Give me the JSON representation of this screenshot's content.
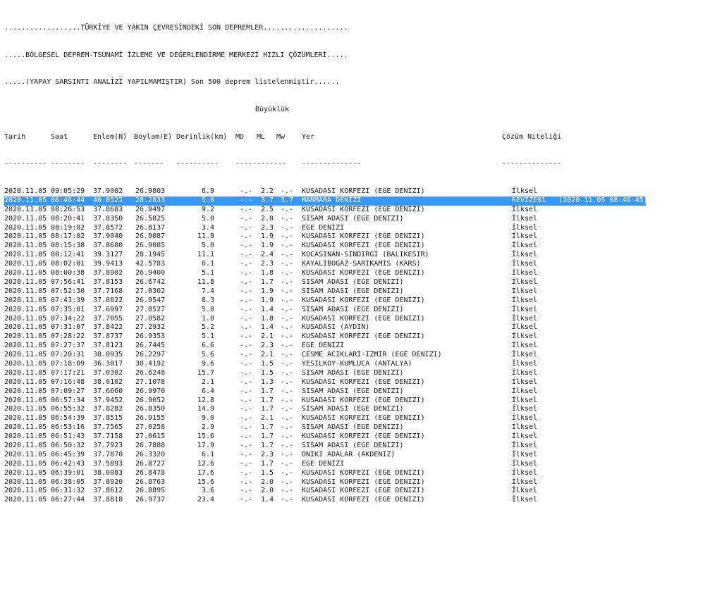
{
  "header": {
    "lines": [
      "..................TÜRKİYE VE YAKIN ÇEVRESİNDEKİ SON DEPREMLER....................",
      ".....BÖLGESEL DEPREM-TSUNAMİ İZLEME VE DEĞERLENDİRME MERKEZİ HIZLI ÇÖZÜMLERİ.....",
      ".....(YAPAY SARSINTI ANALİZİ YAPILMAMIŞTIR) Son 500 deprem listelenmiştir......"
    ],
    "magnitude_group": "Büyüklük"
  },
  "columns": {
    "date": "Tarih",
    "time": "Saat",
    "lat": "Enlem(N)",
    "lon": "Boylam(E)",
    "depth": "Derinlik(km)",
    "md": "MD",
    "ml": "ML",
    "mw": "Mw",
    "location": "Yer",
    "quality": "Çözüm Niteliği"
  },
  "rule": {
    "date": "----------",
    "time": "--------",
    "lat": "--------",
    "lon": "-------",
    "depth": "----------",
    "mag": "------------",
    "location": "--------------",
    "quality": "--------------"
  },
  "selected_index": 1,
  "rows": [
    {
      "date": "2020.11.05",
      "time": "09:05:29",
      "lat": "37.9002",
      "lon": "26.9803",
      "depth": "6.9",
      "md": "-.-",
      "ml": "2.2",
      "mw": "-.-",
      "location": "KUSADASI KORFEZI (EGE DENIZI)",
      "quality": "İlksel"
    },
    {
      "date": "2020.11.05",
      "time": "08:46:44",
      "lat": "40.8522",
      "lon": "28.2833",
      "depth": "5.0",
      "md": "-.-",
      "ml": "3.7",
      "mw": "3.7",
      "location": "MARMARA DENIZI",
      "quality": "REVIZE01   (2020.11.05 08:46:45)"
    },
    {
      "date": "2020.11.05",
      "time": "08:26:53",
      "lat": "37.8683",
      "lon": "26.9497",
      "depth": "9.2",
      "md": "-.-",
      "ml": "2.5",
      "mw": "-.-",
      "location": "KUSADASI KORFEZI (EGE DENIZI)",
      "quality": "İlksel"
    },
    {
      "date": "2020.11.05",
      "time": "08:20:41",
      "lat": "37.8350",
      "lon": "26.5825",
      "depth": "5.0",
      "md": "-.-",
      "ml": "2.0",
      "mw": "-.-",
      "location": "SISAM ADASI (EGE DENIZI)",
      "quality": "İlksel"
    },
    {
      "date": "2020.11.05",
      "time": "08:19:02",
      "lat": "37.8572",
      "lon": "26.8137",
      "depth": "3.4",
      "md": "-.-",
      "ml": "2.3",
      "mw": "-.-",
      "location": "EGE DENIZI",
      "quality": "İlksel"
    },
    {
      "date": "2020.11.05",
      "time": "08:17:02",
      "lat": "37.9040",
      "lon": "26.9087",
      "depth": "11.9",
      "md": "-.-",
      "ml": "1.9",
      "mw": "-.-",
      "location": "KUSADASI KORFEZI (EGE DENIZI)",
      "quality": "İlksel"
    },
    {
      "date": "2020.11.05",
      "time": "08:15:38",
      "lat": "37.8680",
      "lon": "26.9085",
      "depth": "5.0",
      "md": "-.-",
      "ml": "1.9",
      "mw": "-.-",
      "location": "KUSADASI KORFEZI (EGE DENIZI)",
      "quality": "İlksel"
    },
    {
      "date": "2020.11.05",
      "time": "08:12:41",
      "lat": "39.3127",
      "lon": "28.1945",
      "depth": "11.1",
      "md": "-.-",
      "ml": "2.4",
      "mw": "-.-",
      "location": "KOCASINAN-SINDIRGI (BALIKESIR)",
      "quality": "İlksel"
    },
    {
      "date": "2020.11.05",
      "time": "08:02:01",
      "lat": "39.9413",
      "lon": "42.5783",
      "depth": "6.1",
      "md": "-.-",
      "ml": "2.3",
      "mw": "-.-",
      "location": "KAYALIBOGAZ-SARIKAMIS (KARS)",
      "quality": "İlksel"
    },
    {
      "date": "2020.11.05",
      "time": "08:00:38",
      "lat": "37.8902",
      "lon": "26.9400",
      "depth": "5.1",
      "md": "-.-",
      "ml": "1.8",
      "mw": "-.-",
      "location": "KUSADASI KORFEZI (EGE DENIZI)",
      "quality": "İlksel"
    },
    {
      "date": "2020.11.05",
      "time": "07:56:41",
      "lat": "37.8153",
      "lon": "26.6742",
      "depth": "11.8",
      "md": "-.-",
      "ml": "1.7",
      "mw": "-.-",
      "location": "SISAM ADASI (EGE DENIZI)",
      "quality": "İlksel"
    },
    {
      "date": "2020.11.05",
      "time": "07:52:30",
      "lat": "37.7168",
      "lon": "27.0302",
      "depth": "7.4",
      "md": "-.-",
      "ml": "1.9",
      "mw": "-.-",
      "location": "SISAM ADASI (EGE DENIZI)",
      "quality": "İlksel"
    },
    {
      "date": "2020.11.05",
      "time": "07:43:39",
      "lat": "37.8822",
      "lon": "26.9547",
      "depth": "8.3",
      "md": "-.-",
      "ml": "1.9",
      "mw": "-.-",
      "location": "KUSADASI KORFEZI (EGE DENIZI)",
      "quality": "İlksel"
    },
    {
      "date": "2020.11.05",
      "time": "07:35:01",
      "lat": "37.6997",
      "lon": "27.0527",
      "depth": "5.0",
      "md": "-.-",
      "ml": "1.4",
      "mw": "-.-",
      "location": "SISAM ADASI (EGE DENIZI)",
      "quality": "İlksel"
    },
    {
      "date": "2020.11.05",
      "time": "07:34:22",
      "lat": "37.7055",
      "lon": "27.0582",
      "depth": "1.0",
      "md": "-.-",
      "ml": "1.8",
      "mw": "-.-",
      "location": "KUSADASI KORFEZI (EGE DENIZI)",
      "quality": "İlksel"
    },
    {
      "date": "2020.11.05",
      "time": "07:31:07",
      "lat": "37.8422",
      "lon": "27.2932",
      "depth": "5.2",
      "md": "-.-",
      "ml": "1.4",
      "mw": "-.-",
      "location": "KUSADASI (AYDIN)",
      "quality": "İlksel"
    },
    {
      "date": "2020.11.05",
      "time": "07:28:22",
      "lat": "37.8737",
      "lon": "26.9353",
      "depth": "5.1",
      "md": "-.-",
      "ml": "2.1",
      "mw": "-.-",
      "location": "KUSADASI KORFEZI (EGE DENIZI)",
      "quality": "İlksel"
    },
    {
      "date": "2020.11.05",
      "time": "07:27:37",
      "lat": "37.8123",
      "lon": "26.7445",
      "depth": "6.6",
      "md": "-.-",
      "ml": "2.3",
      "mw": "-.-",
      "location": "EGE DENIZI",
      "quality": "İlksel"
    },
    {
      "date": "2020.11.05",
      "time": "07:20:31",
      "lat": "38.0935",
      "lon": "26.2297",
      "depth": "5.6",
      "md": "-.-",
      "ml": "2.1",
      "mw": "-.-",
      "location": "CESME ACIKLARI-IZMIR (EGE DENIZI)",
      "quality": "İlksel"
    },
    {
      "date": "2020.11.05",
      "time": "07:18:09",
      "lat": "36.3017",
      "lon": "30.4192",
      "depth": "9.6",
      "md": "-.-",
      "ml": "1.5",
      "mw": "-.-",
      "location": "YESILKOY-KUMLUCA (ANTALYA)",
      "quality": "İlksel"
    },
    {
      "date": "2020.11.05",
      "time": "07:17:21",
      "lat": "37.0302",
      "lon": "26.6248",
      "depth": "15.7",
      "md": "-.-",
      "ml": "1.5",
      "mw": "-.-",
      "location": "SISAM ADASI (EGE DENIZI)",
      "quality": "İlksel"
    },
    {
      "date": "2020.11.05",
      "time": "07:16:48",
      "lat": "38.0102",
      "lon": "27.1078",
      "depth": "2.1",
      "md": "-.-",
      "ml": "1.3",
      "mw": "-.-",
      "location": "KUSADASI KORFEZI (EGE DENIZI)",
      "quality": "İlksel"
    },
    {
      "date": "2020.11.05",
      "time": "07:09:27",
      "lat": "37.6660",
      "lon": "26.9970",
      "depth": "6.4",
      "md": "-.-",
      "ml": "1.7",
      "mw": "-.-",
      "location": "SISAM ADASI (EGE DENIZI)",
      "quality": "İlksel"
    },
    {
      "date": "2020.11.05",
      "time": "06:57:34",
      "lat": "37.9452",
      "lon": "26.9052",
      "depth": "12.8",
      "md": "-.-",
      "ml": "1.7",
      "mw": "-.-",
      "location": "KUSADASI KORFEZI (EGE DENIZI)",
      "quality": "İlksel"
    },
    {
      "date": "2020.11.05",
      "time": "06:55:32",
      "lat": "37.8282",
      "lon": "26.8350",
      "depth": "14.9",
      "md": "-.-",
      "ml": "1.7",
      "mw": "-.-",
      "location": "SISAM ADASI (EGE DENIZI)",
      "quality": "İlksel"
    },
    {
      "date": "2020.11.05",
      "time": "06:54:39",
      "lat": "37.8515",
      "lon": "26.9155",
      "depth": "9.0",
      "md": "-.-",
      "ml": "2.1",
      "mw": "-.-",
      "location": "KUSADASI KORFEZI (EGE DENIZI)",
      "quality": "İlksel"
    },
    {
      "date": "2020.11.05",
      "time": "06:53:16",
      "lat": "37.7565",
      "lon": "27.0258",
      "depth": "2.9",
      "md": "-.-",
      "ml": "1.7",
      "mw": "-.-",
      "location": "SISAM ADASI (EGE DENIZI)",
      "quality": "İlksel"
    },
    {
      "date": "2020.11.05",
      "time": "06:51:43",
      "lat": "37.7158",
      "lon": "27.0615",
      "depth": "15.6",
      "md": "-.-",
      "ml": "1.7",
      "mw": "-.-",
      "location": "KUSADASI KORFEZI (EGE DENIZI)",
      "quality": "İlksel"
    },
    {
      "date": "2020.11.05",
      "time": "06:50:32",
      "lat": "37.7923",
      "lon": "26.7888",
      "depth": "17.9",
      "md": "-.-",
      "ml": "1.7",
      "mw": "-.-",
      "location": "SISAM ADASI (EGE DENIZI)",
      "quality": "İlksel"
    },
    {
      "date": "2020.11.05",
      "time": "06:45:39",
      "lat": "37.7870",
      "lon": "26.3320",
      "depth": "6.1",
      "md": "-.-",
      "ml": "2.3",
      "mw": "-.-",
      "location": "ONIKI ADALAR (AKDENIZ)",
      "quality": "İlksel"
    },
    {
      "date": "2020.11.05",
      "time": "06:42:43",
      "lat": "37.5893",
      "lon": "26.8727",
      "depth": "12.6",
      "md": "-.-",
      "ml": "1.7",
      "mw": "-.-",
      "location": "EGE DENIZI",
      "quality": "İlksel"
    },
    {
      "date": "2020.11.05",
      "time": "06:39:01",
      "lat": "38.0083",
      "lon": "26.8478",
      "depth": "17.6",
      "md": "-.-",
      "ml": "1.5",
      "mw": "-.-",
      "location": "KUSADASI KORFEZI (EGE DENIZI)",
      "quality": "İlksel"
    },
    {
      "date": "2020.11.05",
      "time": "06:38:05",
      "lat": "37.8920",
      "lon": "26.8763",
      "depth": "15.6",
      "md": "-.-",
      "ml": "2.0",
      "mw": "-.-",
      "location": "KUSADASI KORFEZI (EGE DENIZI)",
      "quality": "İlksel"
    },
    {
      "date": "2020.11.05",
      "time": "06:31:32",
      "lat": "37.8612",
      "lon": "26.8895",
      "depth": "3.6",
      "md": "-.-",
      "ml": "2.0",
      "mw": "-.-",
      "location": "KUSADASI KORFEZI (EGE DENIZI)",
      "quality": "İlksel"
    },
    {
      "date": "2020.11.05",
      "time": "06:27:44",
      "lat": "37.8818",
      "lon": "26.9737",
      "depth": "23.4",
      "md": "-.-",
      "ml": "1.4",
      "mw": "-.-",
      "location": "KUSADASI KORFEZI (EGE DENIZI)",
      "quality": "İlksel"
    }
  ]
}
